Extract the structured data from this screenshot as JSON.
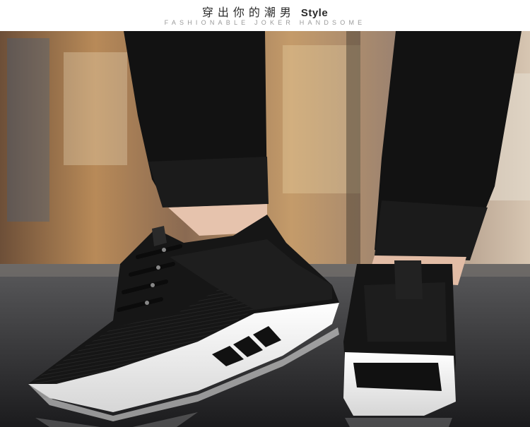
{
  "header": {
    "title_cn": "穿出你的潮男",
    "title_en": "Style",
    "subtitle": "FASHIONABLE JOKER HANDSOME"
  },
  "photo": {
    "subject": "sneaker-photo",
    "colors": {
      "shoe_upper": "#141414",
      "sole": "#f4f4f4",
      "pants": "#111111",
      "skin": "#e8c6b2",
      "background_warm": "#b8864c"
    }
  }
}
